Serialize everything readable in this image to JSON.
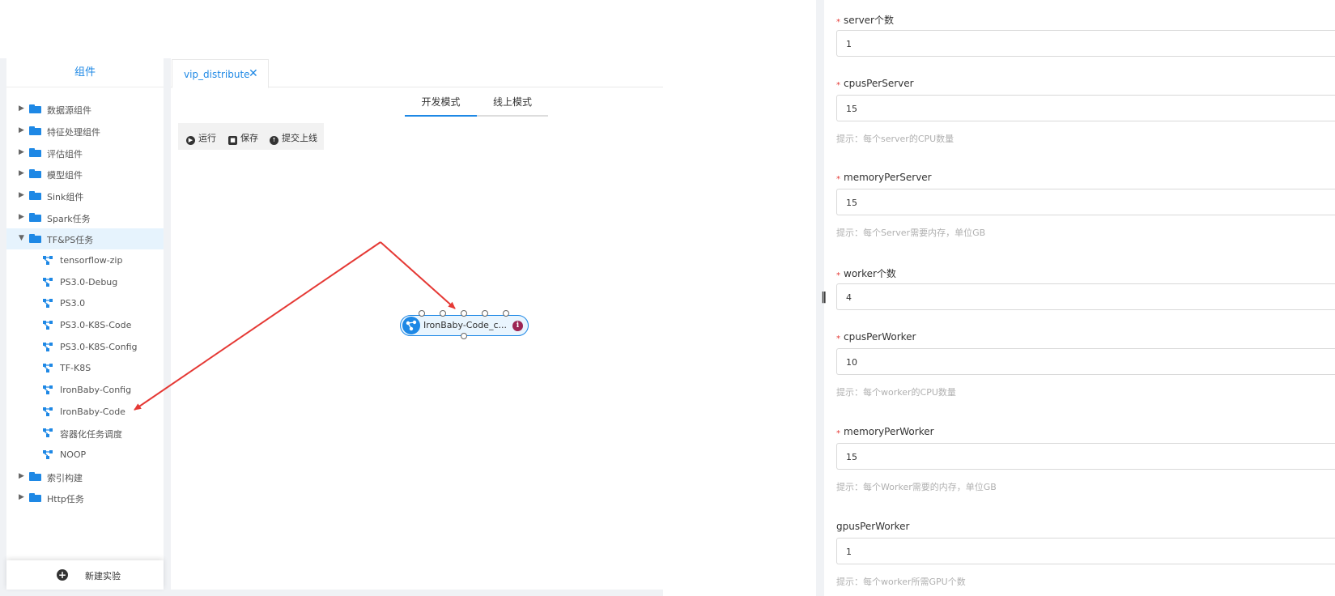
{
  "sidebar": {
    "title": "组件",
    "items": [
      {
        "label": "数据源组件",
        "type": "folder"
      },
      {
        "label": "特征处理组件",
        "type": "folder"
      },
      {
        "label": "评估组件",
        "type": "folder"
      },
      {
        "label": "模型组件",
        "type": "folder"
      },
      {
        "label": "Sink组件",
        "type": "folder"
      },
      {
        "label": "Spark任务",
        "type": "folder"
      },
      {
        "label": "TF&PS任务",
        "type": "folder-open"
      },
      {
        "label": "tensorflow-zip",
        "type": "node"
      },
      {
        "label": "PS3.0-Debug",
        "type": "node"
      },
      {
        "label": "PS3.0",
        "type": "node"
      },
      {
        "label": "PS3.0-K8S-Code",
        "type": "node"
      },
      {
        "label": "PS3.0-K8S-Config",
        "type": "node"
      },
      {
        "label": "TF-K8S",
        "type": "node"
      },
      {
        "label": "IronBaby-Config",
        "type": "node"
      },
      {
        "label": "IronBaby-Code",
        "type": "node"
      },
      {
        "label": "容器化任务调度",
        "type": "node"
      },
      {
        "label": "NOOP",
        "type": "node"
      },
      {
        "label": "索引构建",
        "type": "folder"
      },
      {
        "label": "Http任务",
        "type": "folder"
      }
    ],
    "new_experiment": "新建实验"
  },
  "editor": {
    "tab_label": "vip_distribute",
    "tab_close": "✕",
    "modes": [
      "开发模式",
      "线上模式"
    ],
    "toolbar": {
      "run": "运行",
      "save": "保存",
      "submit": "提交上线"
    },
    "node_label": "IronBaby-Code_c...",
    "node_info": "i"
  },
  "form": {
    "fields": [
      {
        "label": "server个数",
        "required": true,
        "value": "1",
        "hint": ""
      },
      {
        "label": "cpusPerServer",
        "required": true,
        "value": "15",
        "hint": "提示：每个server的CPU数量"
      },
      {
        "label": "memoryPerServer",
        "required": true,
        "value": "15",
        "hint": "提示：每个Server需要内存，单位GB"
      },
      {
        "label": "worker个数",
        "required": true,
        "value": "4",
        "hint": ""
      },
      {
        "label": "cpusPerWorker",
        "required": true,
        "value": "10",
        "hint": "提示：每个worker的CPU数量"
      },
      {
        "label": "memoryPerWorker",
        "required": true,
        "value": "15",
        "hint": "提示：每个Worker需要的内存，单位GB"
      },
      {
        "label": "gpusPerWorker",
        "required": false,
        "value": "1",
        "hint": "提示：每个worker所需GPU个数"
      }
    ],
    "handle": "‖"
  },
  "colors": {
    "accent": "#1e88e5",
    "annotation_arrow": "#e53935",
    "info_badge": "#9c2553"
  }
}
